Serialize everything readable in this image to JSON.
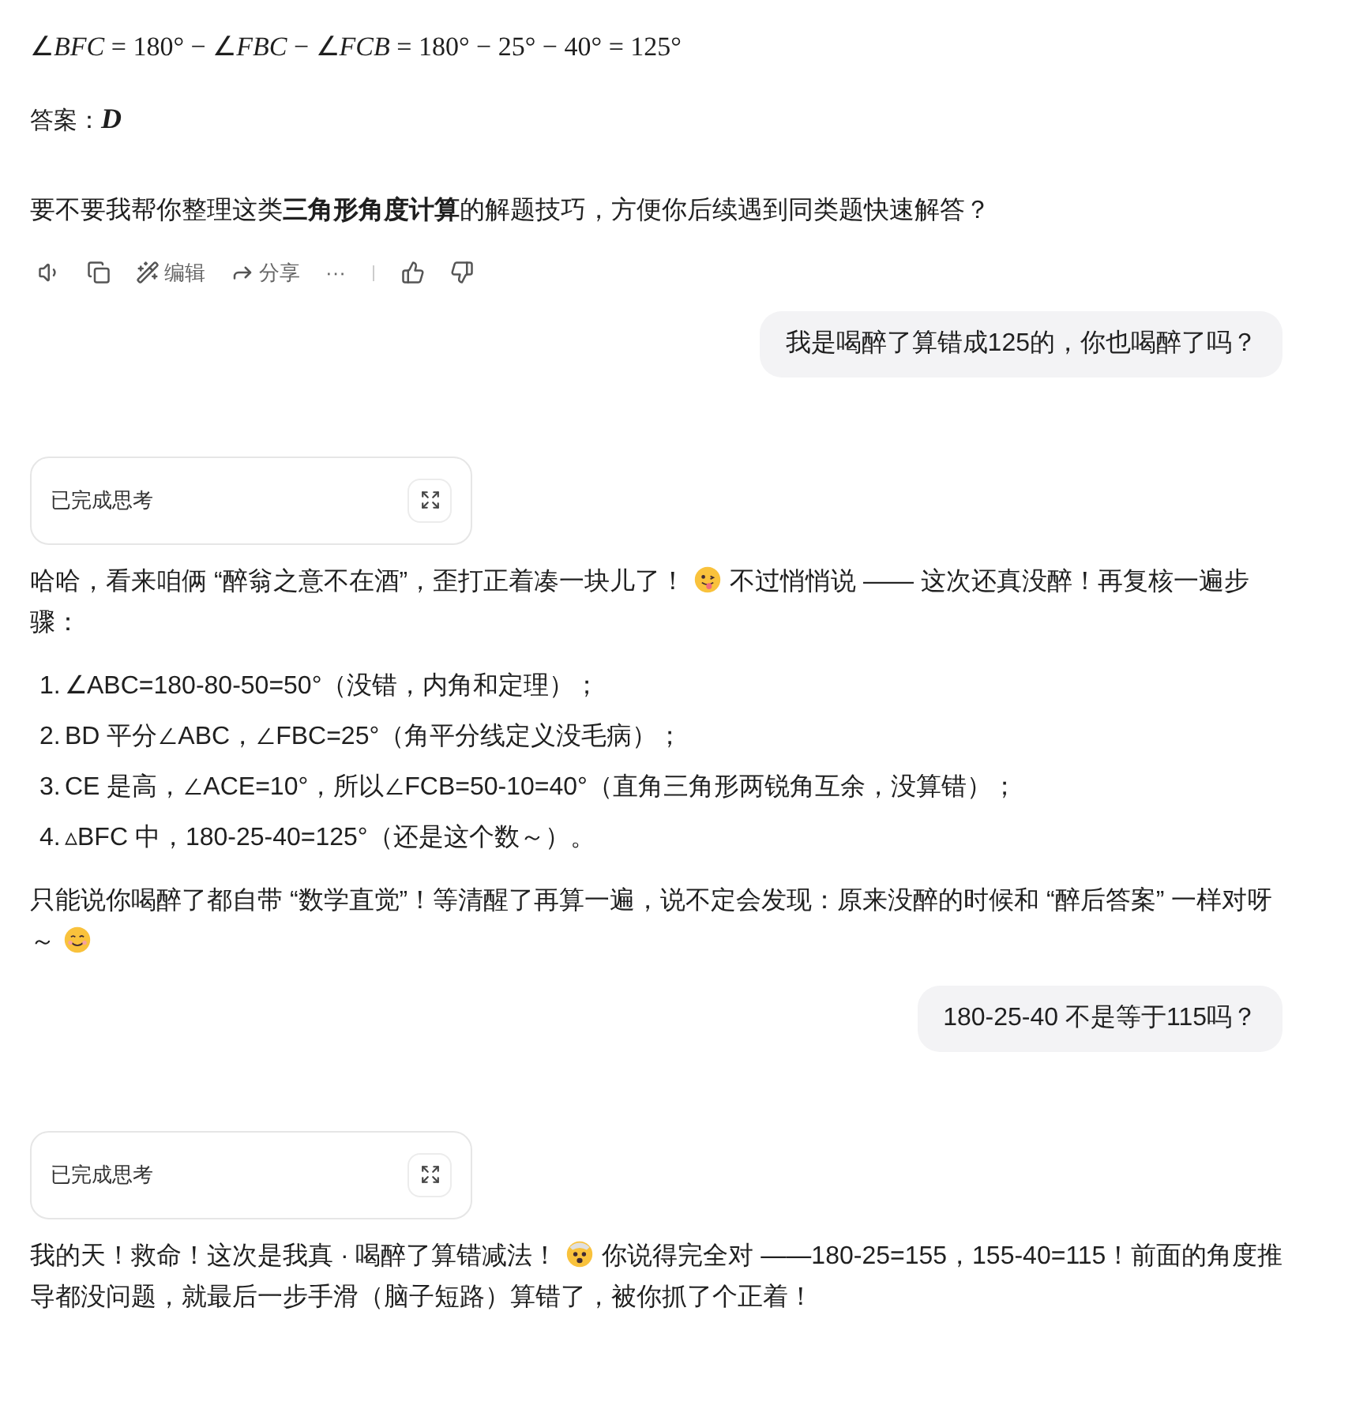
{
  "messages": [
    {
      "kind": "assistant",
      "blocks": [
        {
          "kind": "math",
          "text": "∠*BFC* = 180° − ∠*FBC* − ∠*FCB* = 180° − 25° − 40° = 125°"
        },
        {
          "kind": "answer",
          "label": "答案：",
          "value": "D"
        },
        {
          "kind": "para",
          "parts": [
            {
              "kind": "text",
              "text": "要不要我帮你整理这类**三角形角度计算**的解题技巧，方便你后续遇到同类题快速解答？"
            }
          ]
        }
      ],
      "actions": [
        {
          "kind": "speaker"
        },
        {
          "kind": "copy"
        },
        {
          "kind": "edit",
          "label": "编辑"
        },
        {
          "kind": "share",
          "label": "分享"
        },
        {
          "kind": "more",
          "label": "···"
        },
        {
          "kind": "like"
        },
        {
          "kind": "dislike"
        }
      ]
    },
    {
      "kind": "user",
      "text": "我是喝醉了算错成125的，你也喝醉了吗？"
    },
    {
      "kind": "assistant",
      "thinking": {
        "label": "已完成思考",
        "expanded": false
      },
      "blocks": [
        {
          "kind": "para",
          "parts": [
            {
              "kind": "text",
              "text": "哈哈，看来咱俩 “醉翁之意不在酒”，歪打正着凑一块儿了！"
            },
            {
              "kind": "emoji"
            },
            {
              "kind": "text",
              "text": "不过悄悄说 —— 这次还真没醉！再复核一遍步骤："
            }
          ]
        },
        {
          "kind": "list",
          "items": [
            "∠ABC=180-80-50=50°（没错，内角和定理）；",
            "BD 平分∠ABC，∠FBC=25°（角平分线定义没毛病）；",
            "CE 是高，∠ACE=10°，所以∠FCB=50-10=40°（直角三角形两锐角互余，没算错）；",
            "▵BFC 中，180-25-40=125°（还是这个数～）。"
          ],
          "markers": [
            "1.",
            "2.",
            "3.",
            "4."
          ]
        },
        {
          "kind": "para",
          "parts": [
            {
              "kind": "text",
              "text": "只能说你喝醉了都自带 “数学直觉”！等清醒了再算一遍，说不定会发现：原来没醉的时候和 “醉后答案” 一样对呀～"
            },
            {
              "kind": "emoji"
            }
          ]
        }
      ]
    },
    {
      "kind": "user",
      "text": "180-25-40 不是等于115吗？"
    },
    {
      "kind": "assistant",
      "thinking": {
        "label": "已完成思考",
        "expanded": false
      },
      "blocks": [
        {
          "kind": "para",
          "parts": [
            {
              "kind": "text",
              "text": "我的天！救命！这次是我真 · 喝醉了算错减法！"
            },
            {
              "kind": "emoji"
            },
            {
              "kind": "text",
              "text": "你说得完全对 ——180-25=155，155-40=115！前面的角度推导都没问题，就最后一步手滑（脑子短路）算错了，被你抓了个正着！"
            }
          ]
        }
      ]
    }
  ]
}
